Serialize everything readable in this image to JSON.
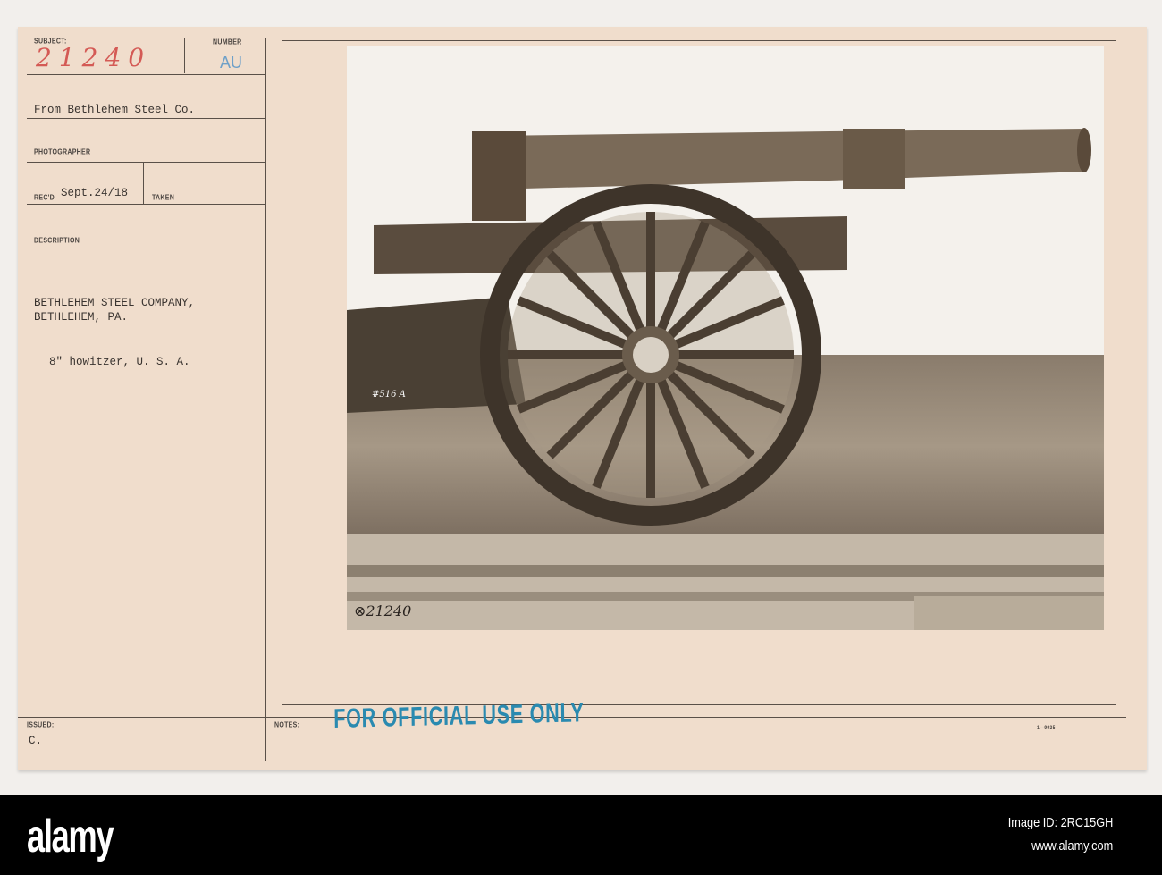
{
  "card": {
    "subject_label": "SUBJECT:",
    "subject_value": "21240",
    "number_label": "NUMBER",
    "number_value": "AU",
    "source": "From Bethlehem Steel Co.",
    "photographer_label": "PHOTOGRAPHER",
    "recd_label": "REC'D",
    "recd_value": "Sept.24/18",
    "taken_label": "TAKEN",
    "description_label": "DESCRIPTION",
    "description_line1": "BETHLEHEM STEEL COMPANY,",
    "description_line2": "BETHLEHEM, PA.",
    "description_line3": "8\" howitzer, U. S. A.",
    "issued_label": "ISSUED:",
    "issued_value": "C.",
    "notes_label": "NOTES:",
    "stamp": "FOR OFFICIAL USE ONLY",
    "form_number": "1—9935"
  },
  "photo": {
    "gun_marking": "#516 A",
    "negative_number": "⊗21240"
  },
  "footer": {
    "logo": "alamy",
    "image_id": "Image ID: 2RC15GH",
    "url": "www.alamy.com"
  }
}
